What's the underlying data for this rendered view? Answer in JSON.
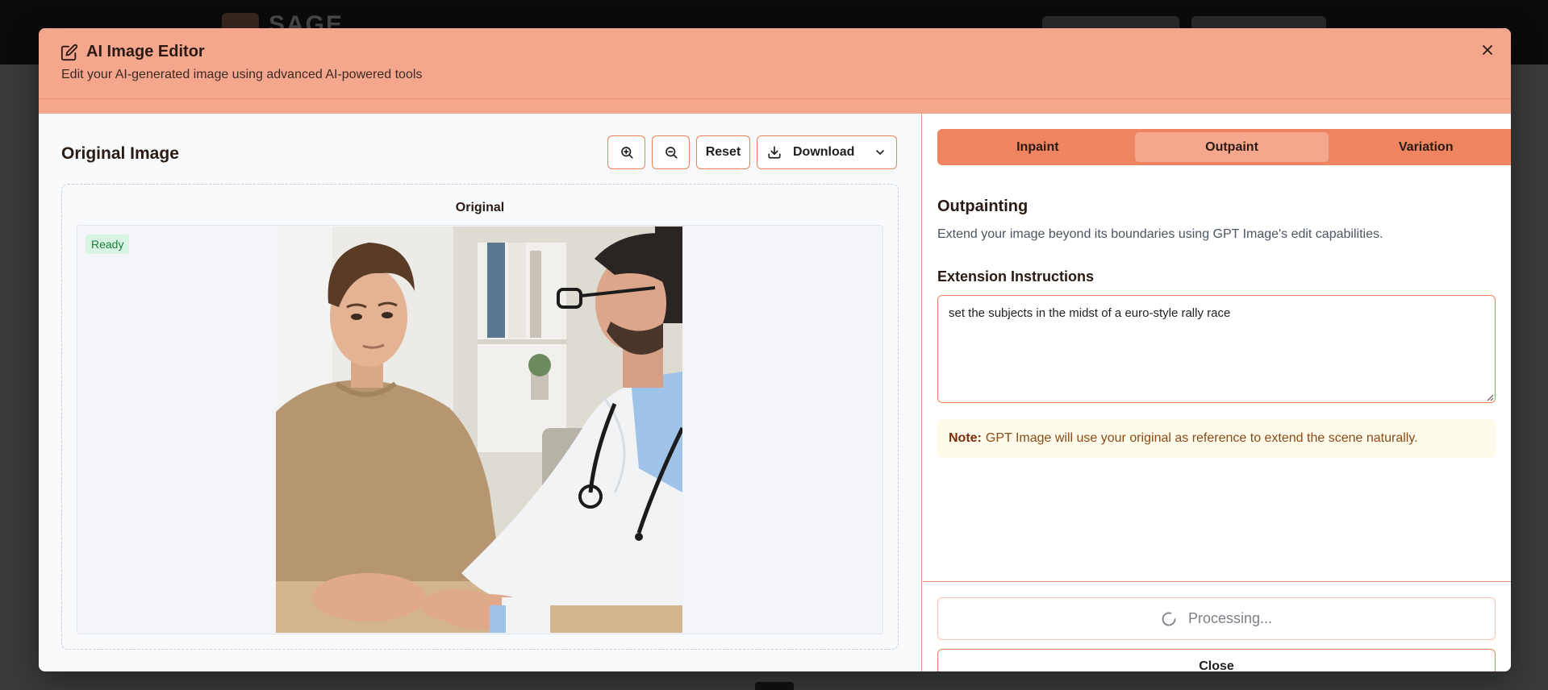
{
  "background": {
    "logo_text": "SAGE"
  },
  "modal": {
    "title": "AI Image Editor",
    "subtitle": "Edit your AI-generated image using advanced AI-powered tools",
    "close_icon": "close-icon"
  },
  "left_panel": {
    "title": "Original Image",
    "toolbar": {
      "zoom_in_icon": "zoom-in-icon",
      "zoom_out_icon": "zoom-out-icon",
      "reset_label": "Reset",
      "download_label": "Download"
    },
    "frame_label": "Original",
    "status_badge": "Ready"
  },
  "right_panel": {
    "tabs": [
      {
        "label": "Inpaint",
        "active": false
      },
      {
        "label": "Outpaint",
        "active": true
      },
      {
        "label": "Variation",
        "active": false
      }
    ],
    "section_title": "Outpainting",
    "section_desc": "Extend your image beyond its boundaries using GPT Image's edit capabilities.",
    "field_label": "Extension Instructions",
    "instructions_value": "set the subjects in the midst of a euro-style rally race",
    "note_label": "Note:",
    "note_text": "GPT Image will use your original as reference to extend the scene naturally.",
    "processing_label": "Processing...",
    "close_label": "Close"
  },
  "colors": {
    "accent": "#ee8560",
    "header": "#f5a78e",
    "border": "#ec8256",
    "ready_bg": "#d7f5e2",
    "note_bg": "#fefbea"
  }
}
